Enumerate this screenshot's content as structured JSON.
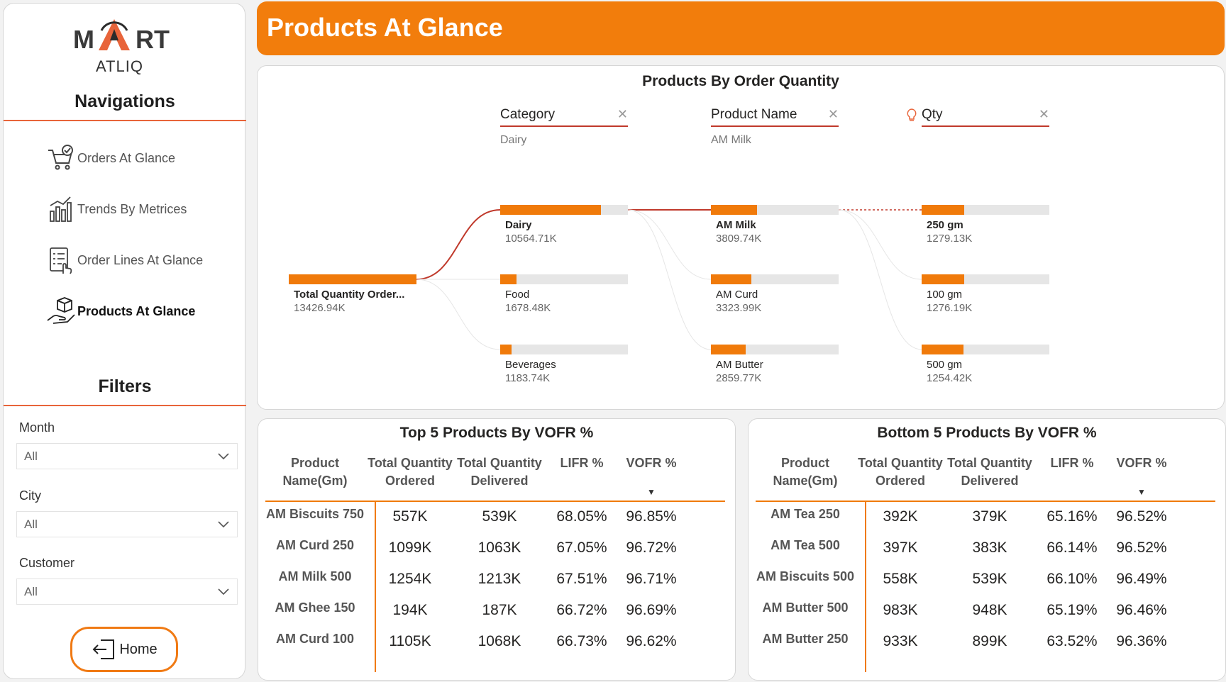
{
  "brand": {
    "logo_left": "M",
    "logo_right": "RT",
    "logo_sub": "ATLIQ"
  },
  "sidebar": {
    "nav_title": "Navigations",
    "items": [
      {
        "label": "Orders At Glance",
        "icon": "cart-check-icon"
      },
      {
        "label": "Trends By Metrices",
        "icon": "bar-trend-icon"
      },
      {
        "label": "Order Lines At Glance",
        "icon": "checklist-hand-icon"
      },
      {
        "label": "Products At Glance",
        "icon": "box-hand-icon",
        "active": true
      }
    ],
    "filters_title": "Filters",
    "filters": [
      {
        "label": "Month",
        "value": "All"
      },
      {
        "label": "City",
        "value": "All"
      },
      {
        "label": "Customer",
        "value": "All"
      }
    ],
    "home_label": "Home"
  },
  "header": {
    "title": "Products At Glance"
  },
  "decomposition": {
    "title": "Products By Order Quantity",
    "levels": [
      {
        "name": "Category",
        "selected": "Dairy"
      },
      {
        "name": "Product Name",
        "selected": "AM Milk"
      },
      {
        "name": "Qty",
        "selected": ""
      }
    ],
    "root": {
      "label": "Total Quantity Order...",
      "value": "13426.94K",
      "fraction": 1.0
    },
    "columns": [
      [
        {
          "label": "Dairy",
          "value": "10564.71K",
          "fraction": 0.787
        },
        {
          "label": "Food",
          "value": "1678.48K",
          "fraction": 0.125
        },
        {
          "label": "Beverages",
          "value": "1183.74K",
          "fraction": 0.088
        }
      ],
      [
        {
          "label": "AM Milk",
          "value": "3809.74K",
          "fraction": 0.361
        },
        {
          "label": "AM Curd",
          "value": "3323.99K",
          "fraction": 0.315
        },
        {
          "label": "AM Butter",
          "value": "2859.77K",
          "fraction": 0.271
        }
      ],
      [
        {
          "label": "250 gm",
          "value": "1279.13K",
          "fraction": 0.336
        },
        {
          "label": "100 gm",
          "value": "1276.19K",
          "fraction": 0.335
        },
        {
          "label": "500 gm",
          "value": "1254.42K",
          "fraction": 0.329
        }
      ]
    ]
  },
  "top5": {
    "title": "Top 5 Products By VOFR %",
    "headers": [
      [
        "Product",
        "Name(Gm)"
      ],
      [
        "Total Quantity",
        "Ordered"
      ],
      [
        "Total Quantity",
        "Delivered"
      ],
      [
        "LIFR %",
        ""
      ],
      [
        "VOFR %",
        ""
      ]
    ],
    "rows": [
      [
        "AM Biscuits 750",
        "557K",
        "539K",
        "68.05%",
        "96.85%"
      ],
      [
        "AM Curd 250",
        "1099K",
        "1063K",
        "67.05%",
        "96.72%"
      ],
      [
        "AM Milk 500",
        "1254K",
        "1213K",
        "67.51%",
        "96.71%"
      ],
      [
        "AM Ghee 150",
        "194K",
        "187K",
        "66.72%",
        "96.69%"
      ],
      [
        "AM Curd 100",
        "1105K",
        "1068K",
        "66.73%",
        "96.62%"
      ]
    ]
  },
  "bottom5": {
    "title": "Bottom 5 Products By VOFR %",
    "headers": [
      [
        "Product",
        "Name(Gm)"
      ],
      [
        "Total Quantity",
        "Ordered"
      ],
      [
        "Total Quantity",
        "Delivered"
      ],
      [
        "LIFR %",
        ""
      ],
      [
        "VOFR %",
        ""
      ]
    ],
    "rows": [
      [
        "AM Tea 250",
        "392K",
        "379K",
        "65.16%",
        "96.52%"
      ],
      [
        "AM Tea 500",
        "397K",
        "383K",
        "66.14%",
        "96.52%"
      ],
      [
        "AM Biscuits 500",
        "558K",
        "539K",
        "66.10%",
        "96.49%"
      ],
      [
        "AM Butter 500",
        "983K",
        "948K",
        "65.19%",
        "96.46%"
      ],
      [
        "AM Butter 250",
        "933K",
        "899K",
        "63.52%",
        "96.36%"
      ]
    ]
  },
  "colors": {
    "accent": "#f27d0c",
    "rule": "#e8643a",
    "path": "#c0392b"
  }
}
